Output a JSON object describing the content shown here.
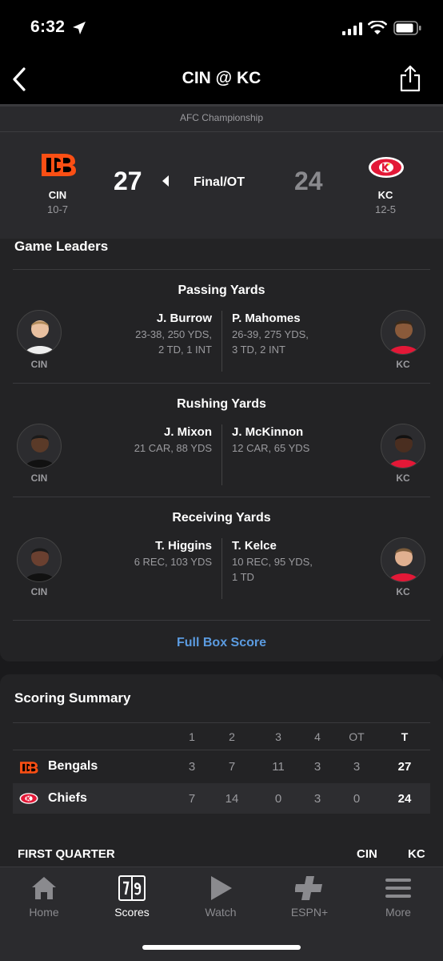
{
  "status_bar": {
    "time": "6:32"
  },
  "nav": {
    "title": "CIN @ KC"
  },
  "game": {
    "event": "AFC Championship",
    "status": "Final/OT",
    "away": {
      "abbr": "CIN",
      "record": "10-7",
      "score": "27",
      "color": "#fb4f14"
    },
    "home": {
      "abbr": "KC",
      "record": "12-5",
      "score": "24",
      "color": "#e31837"
    }
  },
  "leaders": {
    "title": "Game Leaders",
    "categories": [
      {
        "title": "Passing Yards",
        "away": {
          "name": "J. Burrow",
          "line1": "23-38, 250 YDS,",
          "line2": "2 TD, 1 INT",
          "team": "CIN"
        },
        "home": {
          "name": "P. Mahomes",
          "line1": "26-39, 275 YDS,",
          "line2": "3 TD, 2 INT",
          "team": "KC"
        }
      },
      {
        "title": "Rushing Yards",
        "away": {
          "name": "J. Mixon",
          "line1": "21 CAR, 88 YDS",
          "line2": "",
          "team": "CIN"
        },
        "home": {
          "name": "J. McKinnon",
          "line1": "12 CAR, 65 YDS",
          "line2": "",
          "team": "KC"
        }
      },
      {
        "title": "Receiving Yards",
        "away": {
          "name": "T. Higgins",
          "line1": "6 REC, 103 YDS",
          "line2": "",
          "team": "CIN"
        },
        "home": {
          "name": "T. Kelce",
          "line1": "10 REC, 95 YDS,",
          "line2": "1 TD",
          "team": "KC"
        }
      }
    ],
    "full_box_label": "Full Box Score"
  },
  "scoring": {
    "title": "Scoring Summary",
    "columns": [
      "1",
      "2",
      "3",
      "4",
      "OT",
      "T"
    ],
    "rows": [
      {
        "team": "Bengals",
        "scores": [
          "3",
          "7",
          "11",
          "3",
          "3"
        ],
        "total": "27"
      },
      {
        "team": "Chiefs",
        "scores": [
          "7",
          "14",
          "0",
          "3",
          "0"
        ],
        "total": "24"
      }
    ],
    "first_quarter": "FIRST QUARTER",
    "fq_cols": [
      "CIN",
      "KC"
    ]
  },
  "tabs": [
    {
      "label": "Home",
      "icon": "home-icon"
    },
    {
      "label": "Scores",
      "icon": "scores-icon",
      "active": true
    },
    {
      "label": "Watch",
      "icon": "play-icon"
    },
    {
      "label": "ESPN+",
      "icon": "espn-plus-icon"
    },
    {
      "label": "More",
      "icon": "hamburger-icon"
    }
  ]
}
